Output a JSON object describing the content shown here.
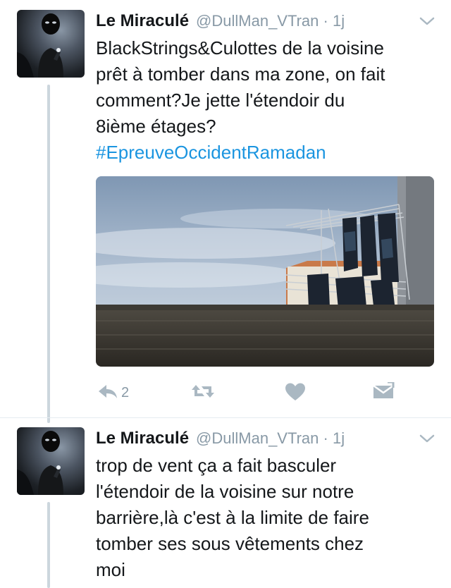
{
  "tweets": [
    {
      "display_name": "Le Miraculé",
      "handle_time": "@DullMan_VTran · 1j",
      "text_lines": [
        "BlackStrings&Culottes de la voisine",
        "prêt à tomber dans ma zone, on fait",
        "comment?Je jette l'étendoir du",
        "8ième étages?"
      ],
      "hashtag": "#EpreuveOccidentRamadan",
      "reply_count": "2",
      "icons": {
        "reply": "reply-icon",
        "retweet": "retweet-icon",
        "like": "heart-icon",
        "dm": "envelope-icon",
        "menu": "chevron-down-icon"
      }
    },
    {
      "display_name": "Le Miraculé",
      "handle_time": "@DullMan_VTran · 1j",
      "text_lines": [
        "trop de vent ça a fait basculer",
        "l'étendoir de la voisine sur notre",
        "barrière,là c'est à la limite de faire",
        "tomber ses sous vêtements chez",
        "moi"
      ]
    }
  ],
  "colors": {
    "text": "#14171a",
    "secondary": "#8899a6",
    "hashtag": "#1b95e0",
    "icon": "#aab8c2",
    "thread_line": "#ccd6dd"
  }
}
